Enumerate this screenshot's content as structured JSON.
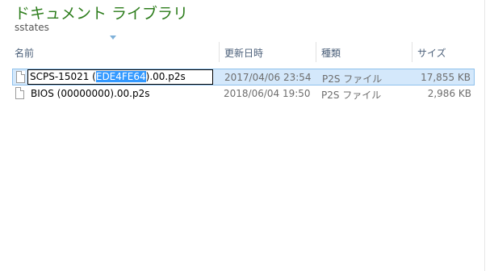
{
  "library": {
    "title": "ドキュメント ライブラリ",
    "subtitle": "sstates"
  },
  "columns": {
    "name": "名前",
    "modified": "更新日時",
    "type": "種類",
    "size": "サイズ"
  },
  "files": [
    {
      "name_prefix": "SCPS-15021 (",
      "name_selected": "EDE4FE64",
      "name_suffix": ").00.p2s",
      "modified": "2017/04/06 23:54",
      "type": "P2S ファイル",
      "size": "17,855 KB"
    },
    {
      "name": "BIOS (00000000).00.p2s",
      "modified": "2018/06/04 19:50",
      "type": "P2S ファイル",
      "size": "2,986 KB"
    }
  ],
  "colors": {
    "title": "#2d7d1c",
    "selection": "#3399ff",
    "row_highlight": "#d4e8fb"
  }
}
